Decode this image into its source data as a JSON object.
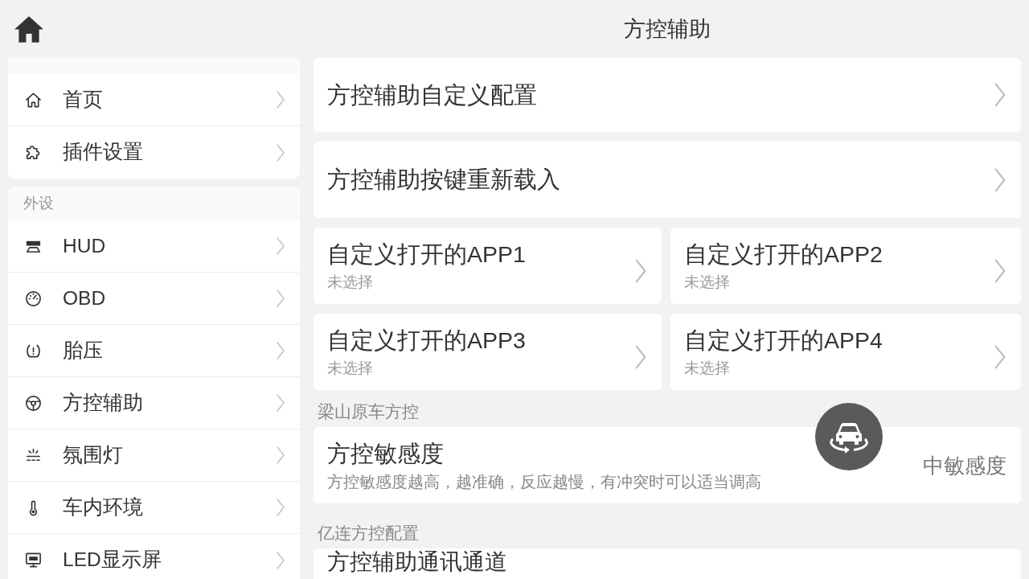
{
  "header": {
    "title": "方控辅助"
  },
  "sidebar": {
    "groups": [
      {
        "items": [
          {
            "label": "首页"
          },
          {
            "label": "插件设置"
          }
        ]
      },
      {
        "title": "外设",
        "items": [
          {
            "label": "HUD"
          },
          {
            "label": "OBD"
          },
          {
            "label": "胎压"
          },
          {
            "label": "方控辅助"
          },
          {
            "label": "氛围灯"
          },
          {
            "label": "车内环境"
          },
          {
            "label": "LED显示屏"
          }
        ]
      }
    ]
  },
  "main": {
    "links": [
      {
        "title": "方控辅助自定义配置"
      },
      {
        "title": "方控辅助按键重新载入"
      }
    ],
    "app_slots": [
      {
        "title": "自定义打开的APP1",
        "value": "未选择"
      },
      {
        "title": "自定义打开的APP2",
        "value": "未选择"
      },
      {
        "title": "自定义打开的APP3",
        "value": "未选择"
      },
      {
        "title": "自定义打开的APP4",
        "value": "未选择"
      }
    ],
    "sections": [
      {
        "title": "梁山原车方控",
        "settings": [
          {
            "title": "方控敏感度",
            "description": "方控敏感度越高，越准确，反应越慢，有冲突时可以适当调高",
            "value": "中敏感度"
          }
        ]
      },
      {
        "title": "亿连方控配置",
        "settings": [
          {
            "title": "方控辅助通讯通道"
          }
        ]
      }
    ]
  }
}
